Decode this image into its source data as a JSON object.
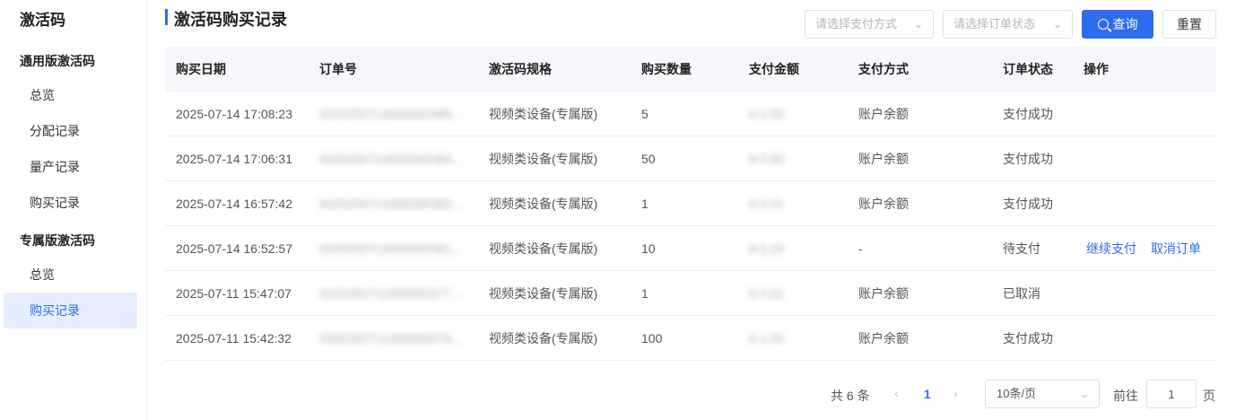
{
  "sidebar": {
    "title": "激活码",
    "group1": "通用版激活码",
    "group1_items": [
      "总览",
      "分配记录",
      "量产记录",
      "购买记录"
    ],
    "group2": "专属版激活码",
    "group2_items": [
      "总览",
      "购买记录"
    ]
  },
  "header": {
    "title": "激活码购买记录",
    "payment_placeholder": "请选择支付方式",
    "status_placeholder": "请选择订单状态",
    "query_label": "查询",
    "reset_label": "重置"
  },
  "table": {
    "columns": [
      "购买日期",
      "订单号",
      "激活码规格",
      "购买数量",
      "支付金额",
      "支付方式",
      "订单状态",
      "操作"
    ],
    "rows": [
      {
        "date": "2025-07-14 17:08:23",
        "order": "0020250714000000365...",
        "spec": "视频类设备(专属版)",
        "qty": "5",
        "amount": "¥ 0.50",
        "method": "账户余额",
        "status": "支付成功",
        "act1": "",
        "act2": ""
      },
      {
        "date": "2025-07-14 17:06:31",
        "order": "0020250714000000364...",
        "spec": "视频类设备(专属版)",
        "qty": "50",
        "amount": "¥ 0.50",
        "method": "账户余额",
        "status": "支付成功",
        "act1": "",
        "act2": ""
      },
      {
        "date": "2025-07-14 16:57:42",
        "order": "0020250714000000362...",
        "spec": "视频类设备(专属版)",
        "qty": "1",
        "amount": "¥ 0.01",
        "method": "账户余额",
        "status": "支付成功",
        "act1": "",
        "act2": ""
      },
      {
        "date": "2025-07-14 16:52:57",
        "order": "0020250714000000361...",
        "spec": "视频类设备(专属版)",
        "qty": "10",
        "amount": "¥ 0.10",
        "method": "-",
        "status": "待支付",
        "act1": "继续支付",
        "act2": "取消订单"
      },
      {
        "date": "2025-07-11 15:47:07",
        "order": "0020250711000000377...",
        "spec": "视频类设备(专属版)",
        "qty": "1",
        "amount": "¥ 0.01",
        "method": "账户余额",
        "status": "已取消",
        "act1": "",
        "act2": ""
      },
      {
        "date": "2025-07-11 15:42:32",
        "order": "0020250711000000376...",
        "spec": "视频类设备(专属版)",
        "qty": "100",
        "amount": "¥ 1.00",
        "method": "账户余额",
        "status": "支付成功",
        "act1": "",
        "act2": ""
      }
    ]
  },
  "pagination": {
    "total_text": "共 6 条",
    "current_page": "1",
    "page_size": "10条/页",
    "goto_label": "前往",
    "goto_value": "1",
    "page_suffix": "页"
  },
  "colors": {
    "accent": "#2e6bef",
    "active_bg": "#e6eeff",
    "header_bg": "#f5f7fa",
    "border": "#ebeef5"
  },
  "icons": [
    "search-icon",
    "chevron-down-icon",
    "chevron-left-icon",
    "chevron-right-icon"
  ]
}
